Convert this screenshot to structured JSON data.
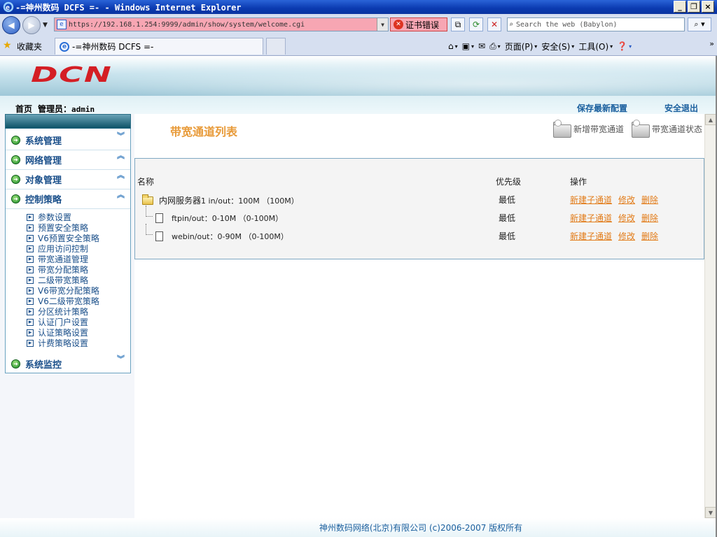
{
  "window": {
    "title": "-=神州数码 DCFS =- - Windows Internet Explorer",
    "min": "_",
    "max": "❐",
    "close": "×"
  },
  "browser": {
    "address": "https://192.168.1.254:9999/admin/show/system/welcome.cgi",
    "cert_error": "证书错误",
    "search_placeholder": "Search the web (Babylon)",
    "favorites_label": "收藏夹",
    "tab_title": "-=神州数码 DCFS =-",
    "cmd": {
      "page": "页面(P)",
      "safety": "安全(S)",
      "tools": "工具(O)"
    }
  },
  "header": {
    "logo": "DCN",
    "home": "首页",
    "admin_label": "管理员：",
    "admin_user": "admin",
    "save_config": "保存最新配置",
    "logout": "安全退出"
  },
  "menu": {
    "sections": [
      {
        "label": "系统管理",
        "state": "collapsed"
      },
      {
        "label": "网络管理",
        "state": "expanded"
      },
      {
        "label": "对象管理",
        "state": "expanded"
      },
      {
        "label": "控制策略",
        "state": "expanded"
      },
      {
        "label": "系统监控",
        "state": "collapsed"
      }
    ],
    "policy_items": [
      "参数设置",
      "预置安全策略",
      "V6预置安全策略",
      "应用访问控制",
      "带宽通道管理",
      "带宽分配策略",
      "二级带宽策略",
      "V6带宽分配策略",
      "V6二级带宽策略",
      "分区统计策略",
      "认证门户设置",
      "认证策略设置",
      "计费策略设置"
    ]
  },
  "content": {
    "title": "带宽通道列表",
    "add_channel": "新增带宽通道",
    "channel_status": "带宽通道状态",
    "headers": {
      "name": "名称",
      "priority": "优先级",
      "actions": "操作"
    },
    "rows": [
      {
        "name": "内网服务器",
        "detail": "1 in/out：100M （100M）",
        "priority": "最低",
        "new_sub": "新建子通道",
        "edit": "修改",
        "delete": "删除"
      },
      {
        "name": "ftp",
        "detail": " in/out：0-10M （0-100M）",
        "priority": "最低",
        "new_sub": "新建子通道",
        "edit": "修改",
        "delete": "删除"
      },
      {
        "name": "web",
        "detail": " in/out：0-90M （0-100M）",
        "priority": "最低",
        "new_sub": "新建子通道",
        "edit": "修改",
        "delete": "删除"
      }
    ]
  },
  "footer": {
    "copyright": "神州数码网络(北京)有限公司 (c)2006-2007 版权所有"
  }
}
